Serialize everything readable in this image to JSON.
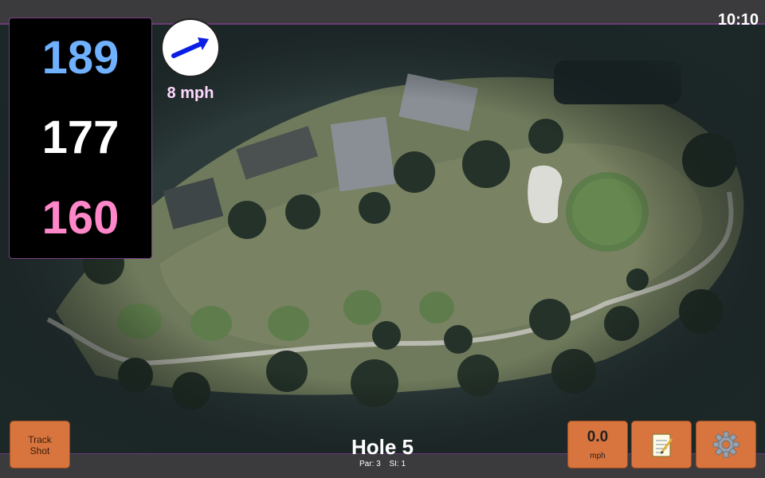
{
  "status": {
    "time": "10:10"
  },
  "yardage": {
    "back": "189",
    "middle": "177",
    "front": "160"
  },
  "wind": {
    "speed": "8 mph",
    "icon": "wind-arrow-icon"
  },
  "hole": {
    "title": "Hole 5",
    "par": "Par: 3",
    "si": "SI: 1"
  },
  "buttons": {
    "track_shot": [
      "Track",
      "Shot"
    ],
    "speed_value": "0.0",
    "speed_unit": "mph",
    "notes_icon": "notepad-icon",
    "settings_icon": "gear-icon"
  },
  "colors": {
    "back_yardage": "#6fb0ff",
    "middle_yardage": "#ffffff",
    "front_yardage": "#ff86c8",
    "button": "#d8743d",
    "accent_border": "#7b3f86"
  }
}
